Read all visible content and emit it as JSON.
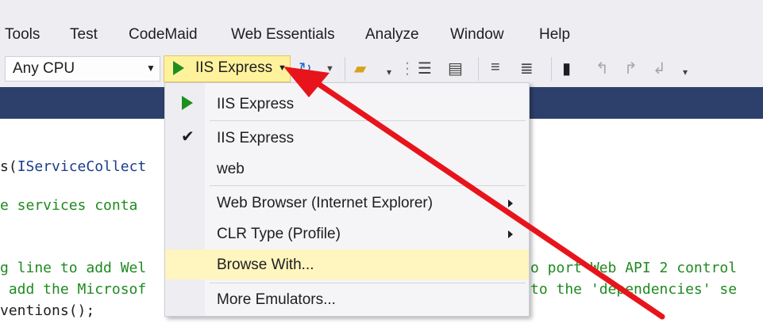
{
  "menubar": {
    "items": [
      "Tools",
      "Test",
      "CodeMaid",
      "Web Essentials",
      "Analyze",
      "Window",
      "Help"
    ]
  },
  "toolbar": {
    "platform": "Any CPU",
    "run_target": "IIS Express",
    "icons": [
      "refresh-icon",
      "folder-search-icon",
      "align-icon",
      "indent-icon",
      "comment-icon",
      "uncomment-icon",
      "bookmark-icon",
      "bookmark-prev-icon",
      "bookmark-next-icon",
      "bookmark-clear-icon"
    ]
  },
  "dropdown": {
    "run_item": "IIS Express",
    "profile_checked": "IIS Express",
    "profile_web": "web",
    "web_browser": "Web Browser (Internet Explorer)",
    "clr_type": "CLR Type (Profile)",
    "browse_with": "Browse With...",
    "more_emulators": "More Emulators..."
  },
  "editor": {
    "line1_prefix": "s(",
    "line1_type": "IServiceCollect",
    "line2": "e services conta",
    "line3_left": "g line to add Wel",
    "line3_right": "o port Web API 2 control",
    "line4_left": " add the Microsof",
    "line4_right": "to the 'dependencies' se",
    "line5": "ventions();"
  },
  "colors": {
    "menubar_bg": "#eeeef2",
    "run_button_bg": "#fff29d",
    "dark_band": "#2d3f6b",
    "highlight": "#fff5bf",
    "arrow": "#e8141b"
  }
}
